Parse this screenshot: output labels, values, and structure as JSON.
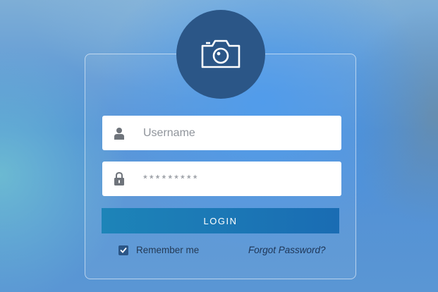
{
  "login_form": {
    "avatar_icon": "camera-icon",
    "username": {
      "icon": "user-icon",
      "placeholder": "Username",
      "value": ""
    },
    "password": {
      "icon": "lock-icon",
      "value": "*********"
    },
    "login_label": "LOGIN",
    "remember": {
      "label": "Remember me",
      "checked": true,
      "icon": "checkmark-icon"
    },
    "forgot_label": "Forgot Password?"
  },
  "colors": {
    "avatar_bg": "#2b5687",
    "button_bg": "#1a78b6",
    "field_bg": "#ffffff"
  }
}
